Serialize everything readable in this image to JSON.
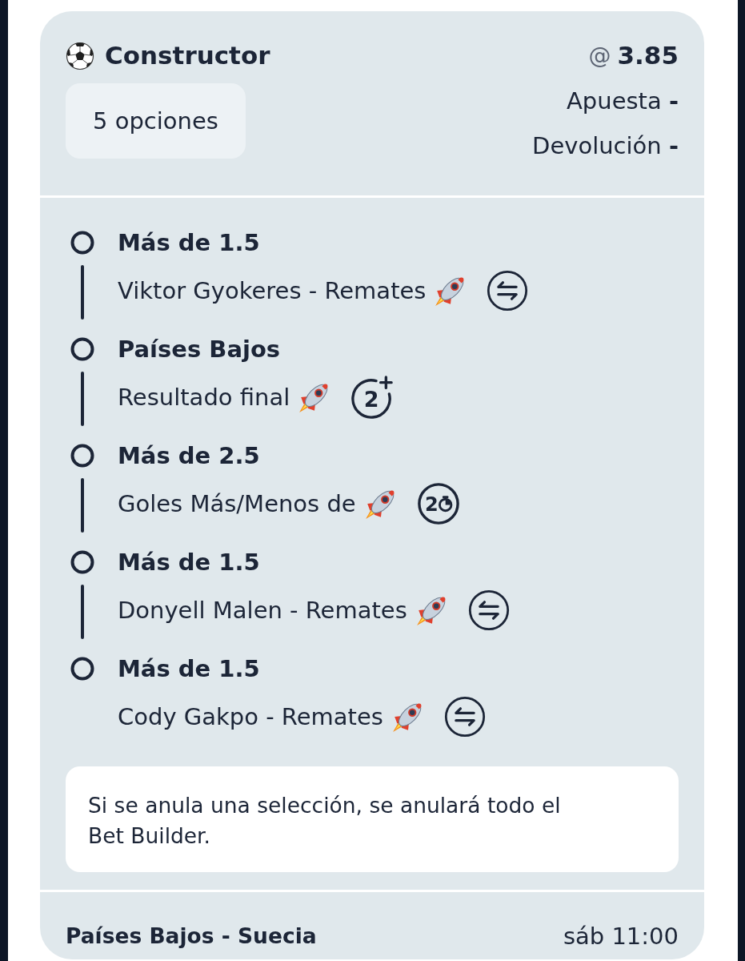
{
  "bet_slip": {
    "title": "Constructor",
    "options_button": "5 opciones",
    "odds": {
      "prefix": "@",
      "value": "3.85"
    },
    "summary": [
      "Apuesta **-**",
      "Devolución **-**"
    ]
  },
  "legs": [
    {
      "selection": "Más de 1.5",
      "market": "Viktor Gyokeres - Remates",
      "boosted": true,
      "badge": {
        "kind": "swap"
      }
    },
    {
      "selection": "Países Bajos",
      "market": "Resultado final",
      "boosted": true,
      "badge": {
        "kind": "plus",
        "label": "2"
      }
    },
    {
      "selection": "Más de 2.5",
      "market": "Goles Más/Menos de",
      "boosted": true,
      "badge": {
        "kind": "clock",
        "label": "2"
      }
    },
    {
      "selection": "Más de 1.5",
      "market": "Donyell Malen - Remates",
      "boosted": true,
      "badge": {
        "kind": "swap"
      }
    },
    {
      "selection": "Más de 1.5",
      "market": "Cody Gakpo - Remates",
      "boosted": true,
      "badge": {
        "kind": "swap"
      }
    }
  ],
  "notice": "Si se anula una selección, se anulará todo el Bet Builder.",
  "footer": {
    "match": "Países Bajos - Suecia",
    "kickoff": "sáb 11:00"
  }
}
